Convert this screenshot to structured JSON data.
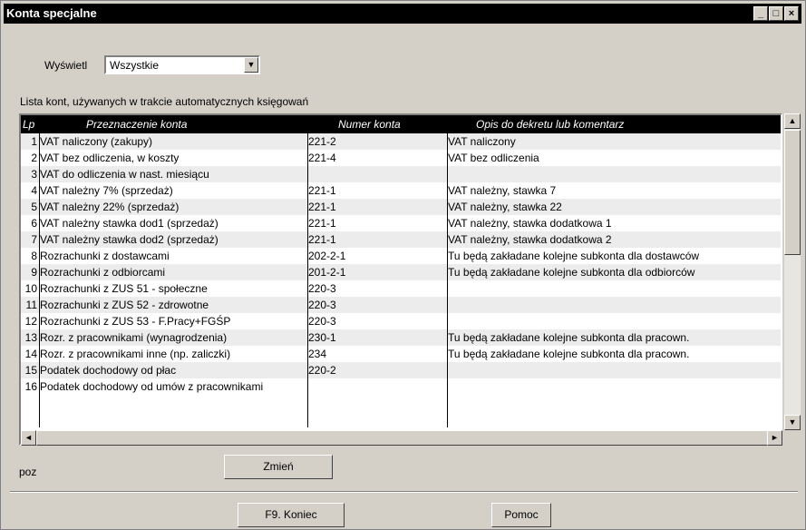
{
  "window": {
    "title": "Konta specjalne",
    "minimize": "_",
    "restore": "□",
    "close": "×"
  },
  "filter": {
    "label": "Wyświetl",
    "value": "Wszystkie"
  },
  "list_caption": "Lista kont, używanych w trakcie automatycznych księgowań",
  "table": {
    "headers": {
      "lp": "Lp",
      "purpose": "Przeznaczenie konta",
      "account": "Numer konta",
      "desc": "Opis do dekretu lub komentarz"
    },
    "rows": [
      {
        "lp": "1",
        "purpose": "VAT naliczony (zakupy)",
        "account": "221-2",
        "desc": "VAT naliczony"
      },
      {
        "lp": "2",
        "purpose": "VAT bez odliczenia, w koszty",
        "account": "221-4",
        "desc": "VAT bez odliczenia"
      },
      {
        "lp": "3",
        "purpose": "VAT do odliczenia w nast. miesiącu",
        "account": "",
        "desc": ""
      },
      {
        "lp": "4",
        "purpose": "VAT należny 7% (sprzedaż)",
        "account": "221-1",
        "desc": "VAT należny, stawka 7"
      },
      {
        "lp": "5",
        "purpose": "VAT należny 22% (sprzedaż)",
        "account": "221-1",
        "desc": "VAT należny, stawka 22"
      },
      {
        "lp": "6",
        "purpose": "VAT należny stawka dod1 (sprzedaż)",
        "account": "221-1",
        "desc": "VAT należny, stawka dodatkowa 1"
      },
      {
        "lp": "7",
        "purpose": "VAT należny stawka dod2 (sprzedaż)",
        "account": "221-1",
        "desc": "VAT należny, stawka dodatkowa 2"
      },
      {
        "lp": "8",
        "purpose": "Rozrachunki z dostawcami",
        "account": "202-2-1",
        "desc": "Tu będą zakładane kolejne subkonta dla dostawców"
      },
      {
        "lp": "9",
        "purpose": "Rozrachunki z odbiorcami",
        "account": "201-2-1",
        "desc": "Tu będą zakładane kolejne subkonta dla odbiorców"
      },
      {
        "lp": "10",
        "purpose": "Rozrachunki z ZUS 51 - społeczne",
        "account": "220-3",
        "desc": ""
      },
      {
        "lp": "11",
        "purpose": "Rozrachunki z ZUS 52 - zdrowotne",
        "account": "220-3",
        "desc": ""
      },
      {
        "lp": "12",
        "purpose": "Rozrachunki z ZUS 53 - F.Pracy+FGŚP",
        "account": "220-3",
        "desc": ""
      },
      {
        "lp": "13",
        "purpose": "Rozr. z pracownikami (wynagrodzenia)",
        "account": "230-1",
        "desc": "Tu będą zakładane kolejne subkonta dla pracown."
      },
      {
        "lp": "14",
        "purpose": "Rozr. z pracownikami inne (np. zaliczki)",
        "account": "234",
        "desc": "Tu będą zakładane kolejne subkonta dla pracown."
      },
      {
        "lp": "15",
        "purpose": "Podatek dochodowy od płac",
        "account": "220-2",
        "desc": ""
      },
      {
        "lp": "16",
        "purpose": "Podatek dochodowy od umów z pracownikami",
        "account": "",
        "desc": ""
      }
    ]
  },
  "status_text": "poz",
  "buttons": {
    "change": "Zmień",
    "end": "F9. Koniec",
    "help": "Pomoc"
  },
  "scroll": {
    "up": "▲",
    "down": "▼",
    "left": "◄",
    "right": "►"
  }
}
